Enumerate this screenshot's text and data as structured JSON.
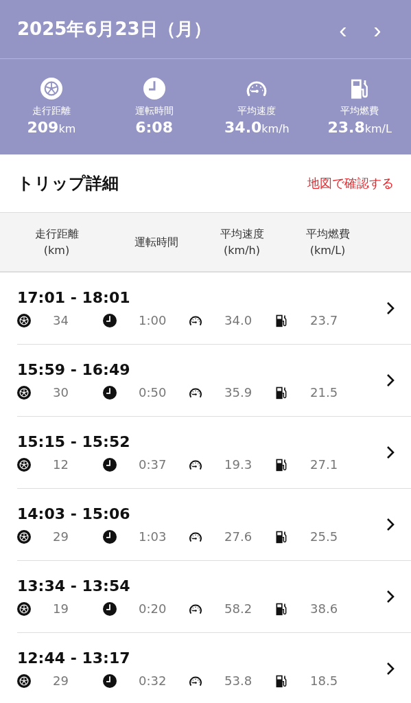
{
  "header": {
    "date": "2025年6月23日（月）",
    "prev": "‹",
    "next": "›"
  },
  "summary": [
    {
      "kind": "distance",
      "label": "走行距離",
      "value": "209",
      "unit": "km"
    },
    {
      "kind": "time",
      "label": "運転時間",
      "value": "6:08"
    },
    {
      "kind": "speed",
      "label": "平均速度",
      "value": "34.0",
      "unit": "km/h"
    },
    {
      "kind": "fuel",
      "label": "平均燃費",
      "value": "23.8",
      "unit": "km/L"
    }
  ],
  "section": {
    "title": "トリップ詳細",
    "link": "地図で確認する"
  },
  "table": {
    "columns": [
      [
        "走行距離",
        "(km)"
      ],
      [
        "運転時間"
      ],
      [
        "平均速度",
        "(km/h)"
      ],
      [
        "平均燃費",
        "(km/L)"
      ]
    ],
    "rows": [
      {
        "time": "17:01 - 18:01",
        "distance": "34",
        "duration": "1:00",
        "speed": "34.0",
        "fuel": "23.7"
      },
      {
        "time": "15:59 - 16:49",
        "distance": "30",
        "duration": "0:50",
        "speed": "35.9",
        "fuel": "21.5"
      },
      {
        "time": "15:15 - 15:52",
        "distance": "12",
        "duration": "0:37",
        "speed": "19.3",
        "fuel": "27.1"
      },
      {
        "time": "14:03 - 15:06",
        "distance": "29",
        "duration": "1:03",
        "speed": "27.6",
        "fuel": "25.5"
      },
      {
        "time": "13:34 - 13:54",
        "distance": "19",
        "duration": "0:20",
        "speed": "58.2",
        "fuel": "38.6"
      },
      {
        "time": "12:44 - 13:17",
        "distance": "29",
        "duration": "0:32",
        "speed": "53.8",
        "fuel": "18.5"
      }
    ]
  }
}
